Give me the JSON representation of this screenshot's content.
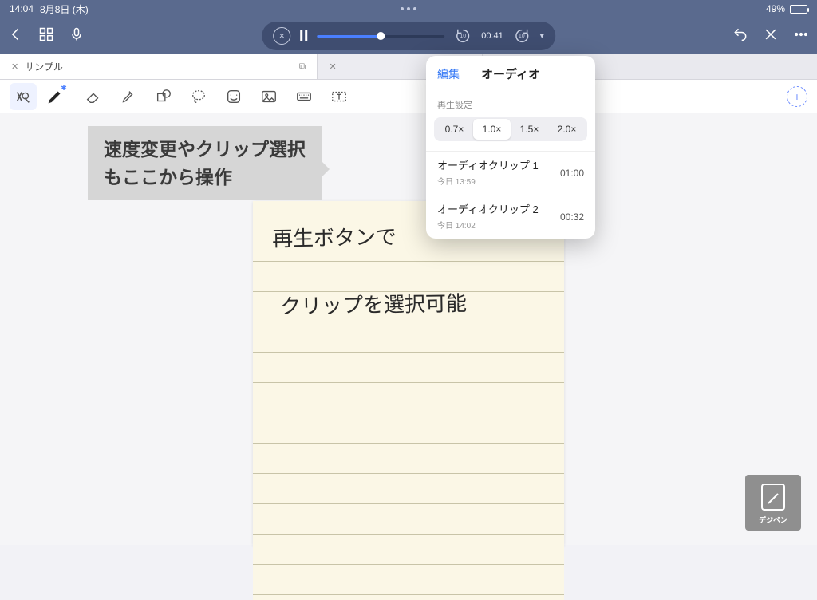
{
  "status": {
    "time": "14:04",
    "date": "8月8日 (木)",
    "battery_pct": "49%"
  },
  "nav": {
    "playtime": "00:41",
    "skip_amount": "10"
  },
  "tabs": {
    "tab1": {
      "label": "サンプル"
    }
  },
  "annotation": {
    "line1": "速度変更やクリップ選択",
    "line2": "もここから操作"
  },
  "handwriting": {
    "l1": "再生ボタンで",
    "l2": "クリップを選択可能"
  },
  "popover": {
    "edit": "編集",
    "title": "オーディオ",
    "section": "再生設定",
    "speeds": [
      "0.7×",
      "1.0×",
      "1.5×",
      "2.0×"
    ],
    "clips": [
      {
        "name": "オーディオクリップ 1",
        "date": "今日 13:59",
        "dur": "01:00"
      },
      {
        "name": "オーディオクリップ 2",
        "date": "今日 14:02",
        "dur": "00:32"
      }
    ]
  },
  "watermark": "デジペン"
}
